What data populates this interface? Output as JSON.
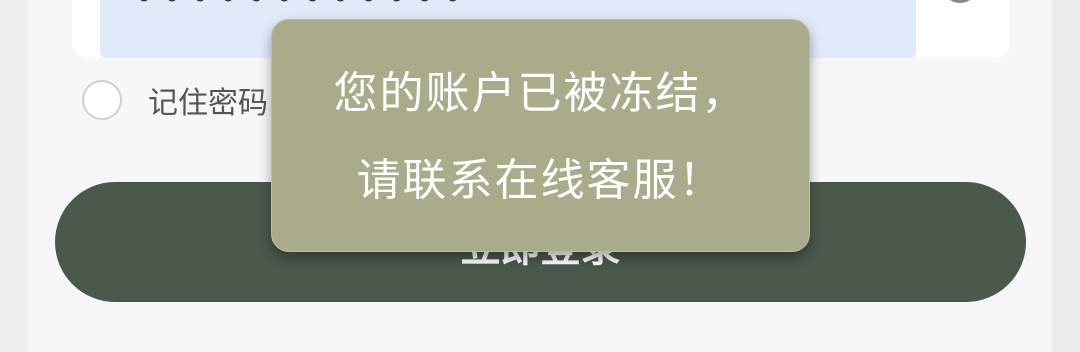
{
  "login_form": {
    "password_mask": "••••••••••••",
    "remember_label": "记住密码",
    "submit_label": "立即登录"
  },
  "icons": {
    "password_toggle": "eye-icon"
  },
  "toast": {
    "line1": "您的账户已被冻结，",
    "line2": "请联系在线客服！"
  },
  "colors": {
    "button": "#4b584c",
    "toast_background": "#a8ac8b",
    "password_field_background": "#e1eafb"
  }
}
